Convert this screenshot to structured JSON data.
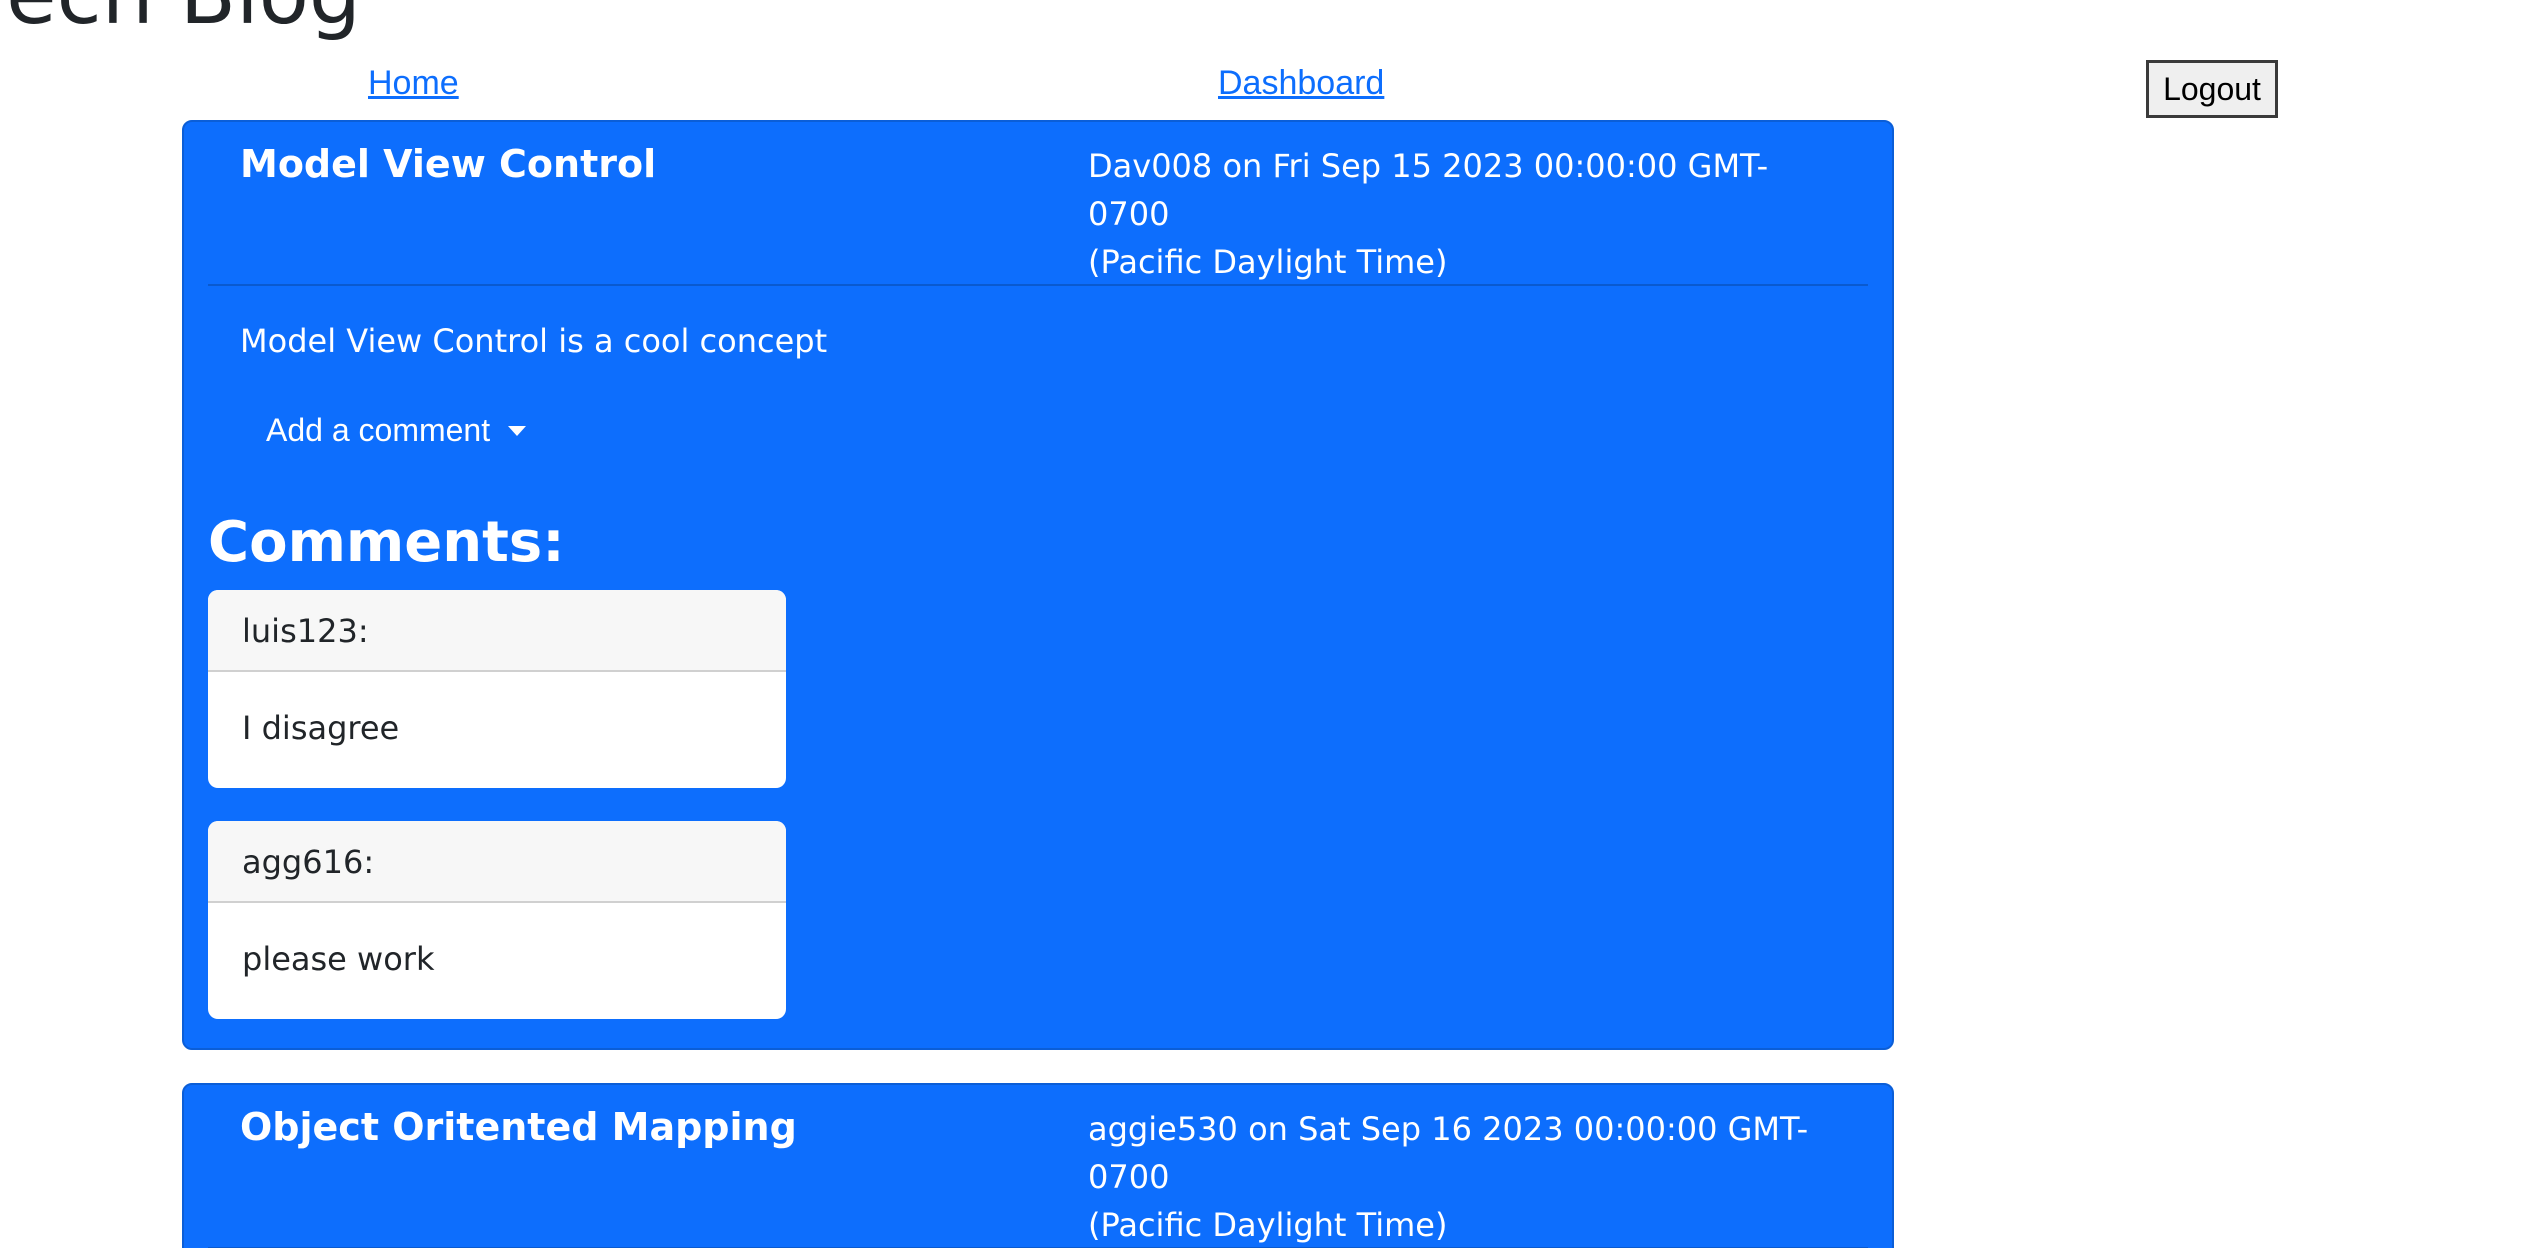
{
  "site": {
    "title": "Tech Blog"
  },
  "nav": {
    "home": "Home",
    "dashboard": "Dashboard",
    "logout": "Logout"
  },
  "posts": [
    {
      "title": "Model View Control",
      "meta_line1": "Dav008 on Fri Sep 15 2023 00:00:00 GMT-0700",
      "meta_line2": "(Pacific Daylight Time)",
      "body": "Model View Control is a cool concept",
      "add_comment": "Add a comment",
      "comments_heading": "Comments:",
      "comments": [
        {
          "author": "luis123:",
          "text": "I disagree"
        },
        {
          "author": "agg616:",
          "text": "please work"
        }
      ]
    },
    {
      "title": "Object Oritented Mapping",
      "meta_line1": "aggie530 on Sat Sep 16 2023 00:00:00 GMT-0700",
      "meta_line2": "(Pacific Daylight Time)"
    }
  ],
  "colors": {
    "accent": "#0d6efd",
    "link": "#0d6efd",
    "card_bg": "#ffffff"
  },
  "icons": {
    "dropdown": "caret-down-icon"
  }
}
